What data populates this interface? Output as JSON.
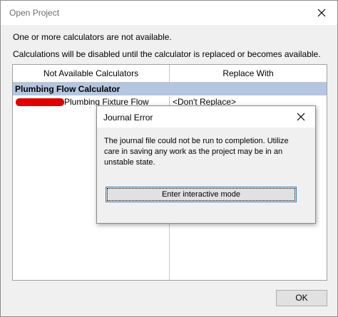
{
  "outer_dialog": {
    "title": "Open Project",
    "message1": "One or more calculators are not available.",
    "message2": "Calculations will be disabled until the calculator is replaced or becomes available.",
    "table": {
      "headers": [
        "Not Available Calculators",
        "Replace With"
      ],
      "group": "Plumbing Flow Calculator",
      "rows": [
        {
          "name": "Plumbing Fixture Flow",
          "replace": "<Don't Replace>"
        }
      ]
    },
    "ok_label": "OK"
  },
  "journal_error": {
    "title": "Journal Error",
    "message": "The journal file could not be run to completion. Utilize care in saving any work as the project may be in an unstable state.",
    "button_label": "Enter interactive mode"
  },
  "colors": {
    "group_row_bg": "#b4c6df",
    "redaction": "#e00000",
    "focus_border": "#3c7fb1"
  }
}
